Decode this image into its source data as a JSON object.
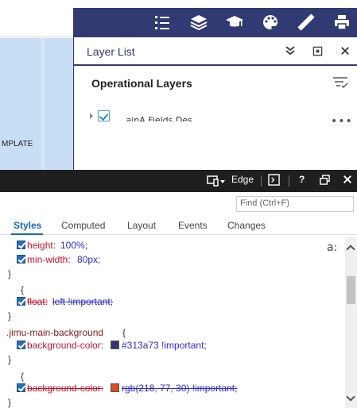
{
  "app": {
    "map_label": "MPLATE",
    "panel": {
      "title": "Layer List",
      "operational_layers": "Operational Layers",
      "layer_name": "...ainA Fields Des..."
    }
  },
  "toolbar": {
    "icons": [
      "list-icon",
      "layers-icon",
      "graduation-cap-icon",
      "palette-icon",
      "ruler-icon",
      "print-icon"
    ],
    "color": "#313a73"
  },
  "devtools": {
    "emulation_label": "Edge",
    "help_label": "?",
    "find_placeholder": "Find (Ctrl+F)",
    "tabs": [
      "Styles",
      "Computed",
      "Layout",
      "Events",
      "Changes"
    ],
    "a_label": "a:",
    "rules": {
      "r1_height_prop": "height:",
      "r1_height_val": "100%;",
      "r1_minwidth_prop": "min-width:",
      "r1_minwidth_val": "80px;",
      "close1": "}",
      "open2": "{",
      "r2_float_prop": "float:",
      "r2_float_val": "left !important;",
      "close2": "}",
      "selector3": ".jimu-main-background",
      "open3": "{",
      "r3_bg_prop": "background-color:",
      "r3_bg_val": "#313a73 !important;",
      "r3_swatch": "#313a73",
      "close3": "}",
      "open4": "{",
      "r4_bg_prop": "background-color:",
      "r4_bg_val": "rgb(218, 77, 30) !important;",
      "r4_swatch": "#da4d1e",
      "close4": "}"
    }
  }
}
